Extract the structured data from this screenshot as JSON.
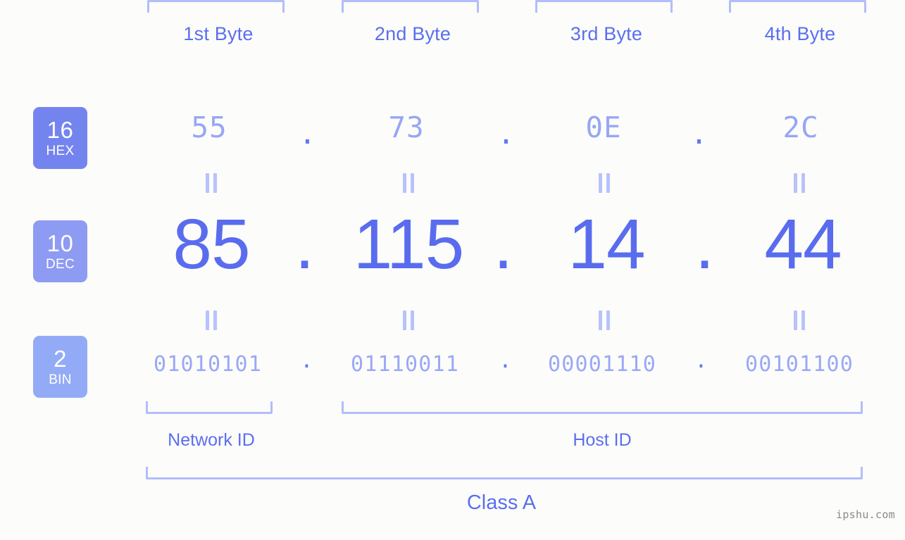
{
  "meta": {
    "background_color": "#fcfdfa",
    "accent_color": "#5a6cee",
    "accent_light": "#98a6f5",
    "bracket_color": "#b3bdfb",
    "watermark": "ipshu.com"
  },
  "headers": [
    {
      "label": "1st Byte"
    },
    {
      "label": "2nd Byte"
    },
    {
      "label": "3rd Byte"
    },
    {
      "label": "4th Byte"
    }
  ],
  "rows": [
    {
      "key": "hex",
      "badge_number": "16",
      "badge_abbr": "HEX",
      "badge_color": "#7484ef",
      "separator": ".",
      "values": [
        "55",
        "73",
        "0E",
        "2C"
      ]
    },
    {
      "key": "dec",
      "badge_number": "10",
      "badge_abbr": "DEC",
      "badge_color": "#8e9bf2",
      "separator": ".",
      "values": [
        "85",
        "115",
        "14",
        "44"
      ]
    },
    {
      "key": "bin",
      "badge_number": "2",
      "badge_abbr": "BIN",
      "badge_color": "#93abf6",
      "separator": ".",
      "values": [
        "01010101",
        "01110011",
        "00001110",
        "00101100"
      ]
    }
  ],
  "equality_symbol": "=",
  "sections": {
    "network_id": "Network ID",
    "host_id": "Host ID",
    "class": "Class A"
  }
}
